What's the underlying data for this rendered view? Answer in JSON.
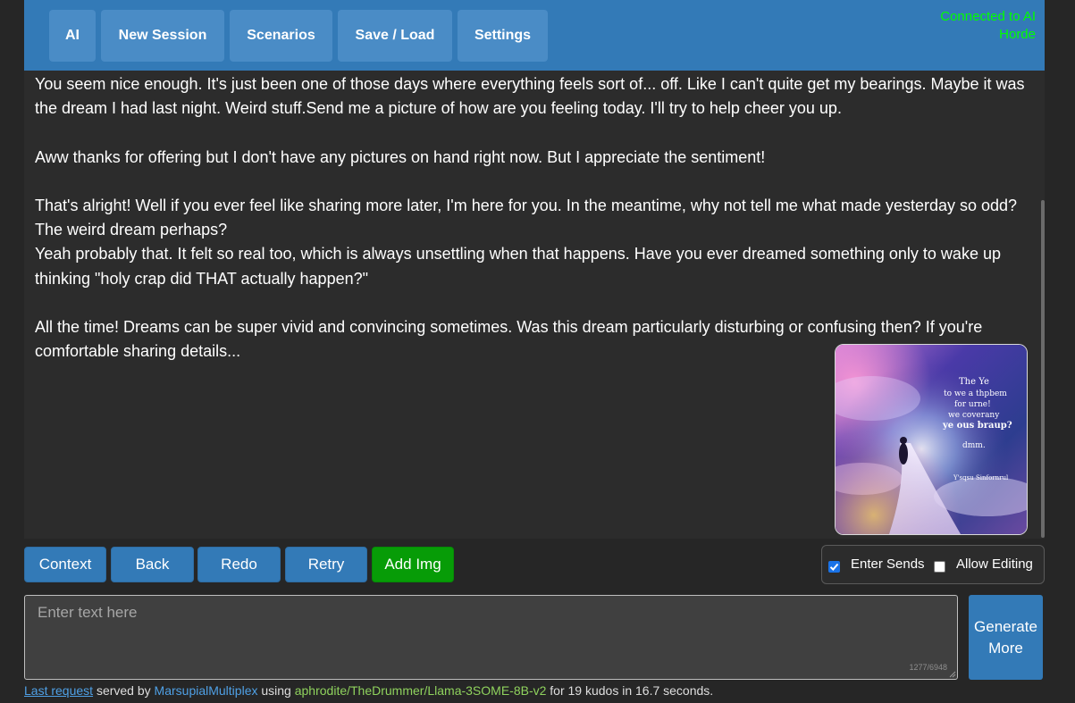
{
  "nav": {
    "buttons": [
      "AI",
      "New Session",
      "Scenarios",
      "Save / Load",
      "Settings"
    ],
    "status": "Connected to AI Horde"
  },
  "chat": {
    "paragraphs": [
      "You seem nice enough. It's just been one of those days where everything feels sort of... off. Like I can't quite get my bearings. Maybe it was the dream I had last night. Weird stuff.Send me a picture of how are you feeling today. I'll try to help cheer you up.",
      "Aww thanks for offering but I don't have any pictures on hand right now. But I appreciate the sentiment!",
      "That's alright! Well if you ever feel like sharing more later, I'm here for you. In the meantime, why not tell me what made yesterday so odd? The weird dream perhaps?",
      "Yeah probably that. It felt so real too, which is always unsettling when that happens. Have you ever dreamed something only to wake up thinking \"holy crap did THAT actually happen?\"",
      "All the time! Dreams can be super vivid and convincing sometimes. Was this dream particularly disturbing or confusing then? If you're comfortable sharing details..."
    ],
    "image": {
      "lines": [
        "The Ye",
        "to we a thpbem",
        "for urne!",
        "we coverany",
        "ye ous braup?",
        "dmm."
      ],
      "signature": "Y'sqsu Sinfornrul"
    }
  },
  "actions": {
    "context": "Context",
    "back": "Back",
    "redo": "Redo",
    "retry": "Retry",
    "add_img": "Add Img"
  },
  "options": {
    "enter_sends": "Enter Sends",
    "enter_sends_checked": true,
    "allow_editing": "Allow Editing",
    "allow_editing_checked": false
  },
  "input": {
    "placeholder": "Enter text here",
    "value": "",
    "count": "1277/6948"
  },
  "generate": {
    "line1": "Generate",
    "line2": "More"
  },
  "footer": {
    "link": "Last request",
    "served_by": " served by ",
    "worker": "MarsupialMultiplex",
    "using": " using ",
    "model": "aphrodite/TheDrummer/Llama-3SOME-8B-v2",
    "tail": " for 19 kudos in 16.7 seconds."
  },
  "colors": {
    "primary": "#337ab7",
    "success": "#079c07",
    "status_green": "#00ff00",
    "background": "#262626"
  }
}
